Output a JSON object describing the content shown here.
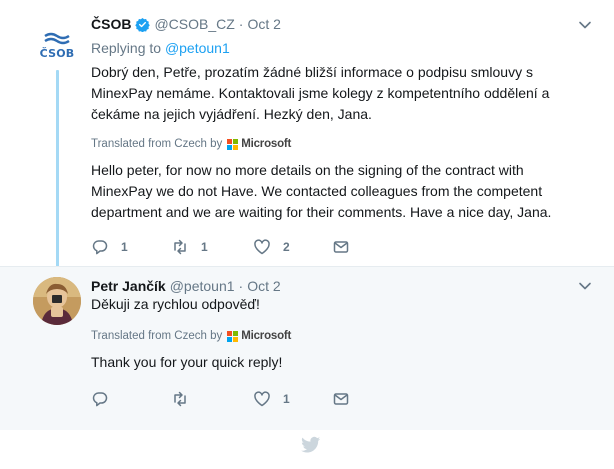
{
  "tweets": [
    {
      "author_name": "ČSOB",
      "author_handle": "@CSOB_CZ",
      "date": "Oct 2",
      "avatar_text": "ČSOB",
      "replying_label": "Replying to",
      "replying_handle": "@petoun1",
      "original_text": "Dobrý den, Petře, prozatím žádné bližší informace o podpisu smlouvy s MinexPay nemáme. Kontaktovali jsme kolegy z kompetentního oddělení a čekáme na jejich vyjádření. Hezký den, Jana.",
      "translated_label": "Translated from Czech by",
      "translator_name": "Microsoft",
      "translated_text": "Hello peter, for now no more details on the signing of the contract with MinexPay we do not Have. We contacted colleagues from the competent department and we are waiting for their comments. Have a nice day, Jana.",
      "reply_count": "1",
      "retweet_count": "1",
      "like_count": "2"
    },
    {
      "author_name": "Petr Jančík",
      "author_handle": "@petoun1",
      "date": "Oct 2",
      "original_text": "Děkuji za rychlou odpověď!",
      "translated_label": "Translated from Czech by",
      "translator_name": "Microsoft",
      "translated_text": "Thank you for your quick reply!",
      "like_count": "1"
    }
  ],
  "colors": {
    "accent": "#1da1f2",
    "thread_line": "#a4d9f5",
    "muted_text": "#657786",
    "brand_csob": "#2f6db3",
    "reply_background": "#f5f8fa"
  },
  "icons": [
    "verified-badge-icon",
    "chevron-down-icon",
    "reply-icon",
    "retweet-icon",
    "like-icon",
    "direct-message-icon",
    "twitter-bird-icon",
    "microsoft-logo-icon"
  ]
}
